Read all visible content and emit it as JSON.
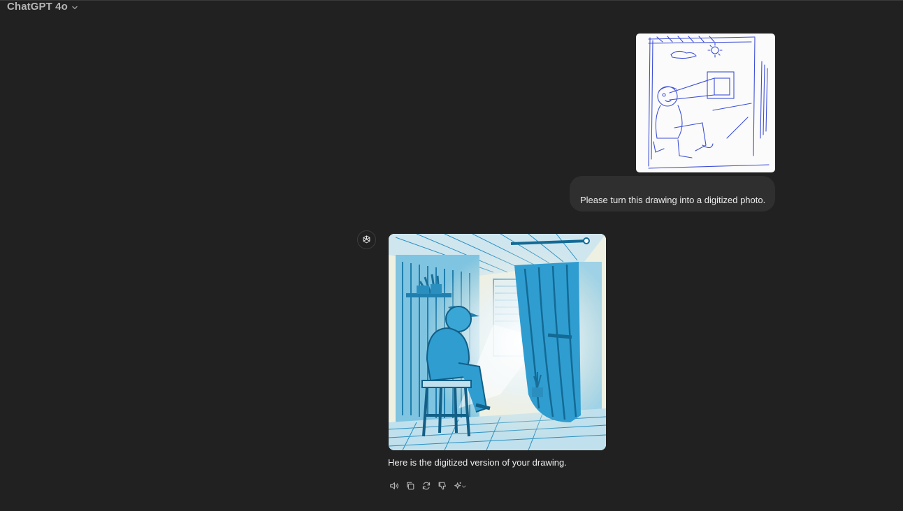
{
  "header": {
    "model_label": "ChatGPT 4o",
    "model_icon": "chevron-down-icon"
  },
  "conversation": {
    "user_message": {
      "image_alt": "hand-drawn sketch",
      "text": "Please turn this drawing into a digitized photo."
    },
    "assistant_message": {
      "avatar_icon": "openai-logo-icon",
      "image_alt": "digitized illustration",
      "text": "Here is the digitized version of your drawing."
    }
  },
  "message_actions": [
    {
      "name": "read-aloud-button",
      "icon": "speaker-icon"
    },
    {
      "name": "copy-button",
      "icon": "copy-icon"
    },
    {
      "name": "regenerate-button",
      "icon": "refresh-icon"
    },
    {
      "name": "thumbs-down-button",
      "icon": "thumbs-down-icon"
    },
    {
      "name": "change-model-button",
      "icon": "sparkle-icon"
    }
  ],
  "colors": {
    "background": "#212121",
    "user_bubble": "#2f2f2f",
    "text": "#ececec",
    "sketch_ink": "#3d4fd6",
    "illustration_blue": "#1f8fc4"
  }
}
